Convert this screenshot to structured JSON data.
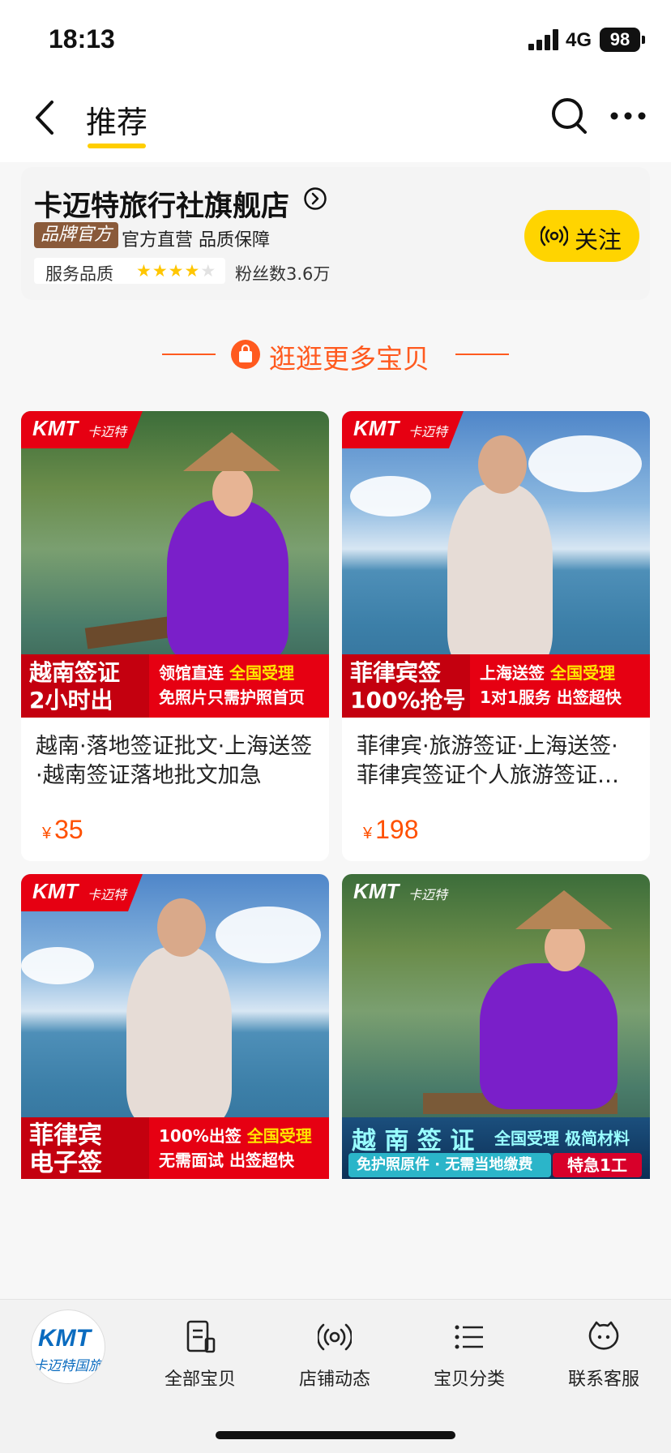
{
  "status_bar": {
    "time": "18:13",
    "network": "4G",
    "battery": "98"
  },
  "header": {
    "title": "推荐"
  },
  "store": {
    "name": "卡迈特旅行社旗舰店",
    "badge": "品牌官方",
    "tagline": "官方直营 品质保障",
    "rating_label": "服务品质",
    "rating_stars": 4,
    "fans": "粉丝数3.6万",
    "follow_label": "关注"
  },
  "section": {
    "title": "逛逛更多宝贝"
  },
  "products": [
    {
      "logo": "KMT",
      "logo_cn": "卡迈特",
      "banner_left": "越南签证\n2小时出",
      "banner_right_1": "领馆直连",
      "banner_right_1_hl": "全国受理",
      "banner_right_2": "免照片只需护照首页",
      "title": "越南·落地签证批文·上海送签·越南签证落地批文加急",
      "price": "35",
      "currency": "¥"
    },
    {
      "logo": "KMT",
      "logo_cn": "卡迈特",
      "banner_left": "菲律宾签\n100%抢号",
      "banner_right_1": "上海送签",
      "banner_right_1_hl": "全国受理",
      "banner_right_2": "1对1服务 出签超快",
      "title": "菲律宾·旅游签证·上海送签·菲律宾签证个人旅游签证…",
      "price": "198",
      "currency": "¥"
    },
    {
      "logo": "KMT",
      "logo_cn": "卡迈特",
      "banner_left": "菲律宾\n电子签",
      "banner_right_1": "100%出签",
      "banner_right_1_hl": "全国受理",
      "banner_right_2": "无需面试 出签超快"
    },
    {
      "logo": "KMT",
      "logo_cn": "卡迈特",
      "banner_left": "越 南 签 证",
      "banner_right_1": "全国受理 极简材料",
      "banner_right_2": "免护照原件 · 无需当地缴费",
      "banner_badge": "特急1工"
    }
  ],
  "tabbar": {
    "shop_logo": "KMT",
    "shop_logo_cn": "卡迈特国旅",
    "items": [
      {
        "label": "全部宝贝",
        "icon": "document-icon"
      },
      {
        "label": "店铺动态",
        "icon": "broadcast-icon"
      },
      {
        "label": "宝贝分类",
        "icon": "list-icon"
      },
      {
        "label": "联系客服",
        "icon": "service-icon"
      }
    ]
  }
}
